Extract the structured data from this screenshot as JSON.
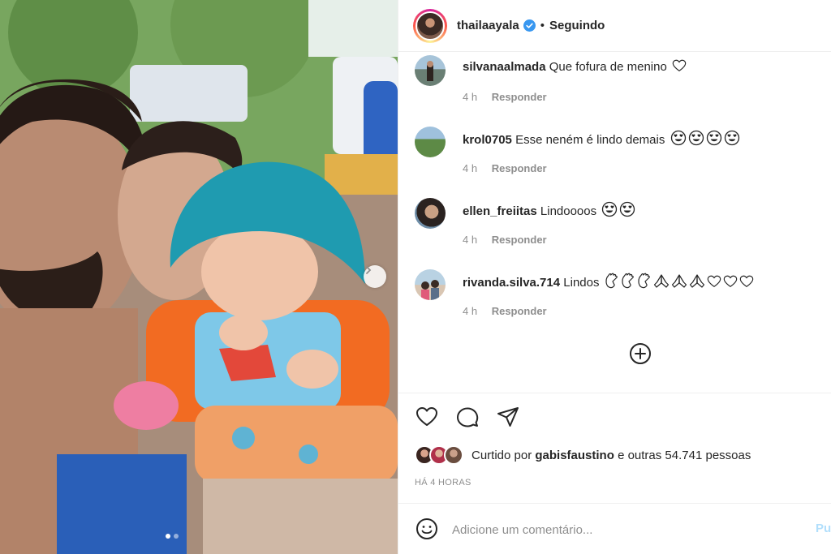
{
  "post": {
    "author": "thailaayala",
    "separator": "•",
    "follow_status": "Seguindo",
    "time_ago": "HÁ 4 HORAS"
  },
  "comments": [
    {
      "username": "silvanaalmada",
      "text": "Que fofura de menino",
      "emojis": [
        "white-heart"
      ],
      "time": "4 h",
      "reply_label": "Responder"
    },
    {
      "username": "krol0705",
      "text": "Esse neném é lindo demais",
      "emojis": [
        "heart-eyes",
        "heart-eyes",
        "heart-eyes",
        "heart-eyes"
      ],
      "time": "4 h",
      "reply_label": "Responder"
    },
    {
      "username": "ellen_freiitas",
      "text": "Lindoooos",
      "emojis": [
        "heart-eyes",
        "heart-eyes"
      ],
      "time": "4 h",
      "reply_label": "Responder"
    },
    {
      "username": "rivanda.silva.714",
      "text": "Lindos",
      "emojis": [
        "clapping-hands",
        "clapping-hands",
        "clapping-hands",
        "folded-hands",
        "folded-hands",
        "folded-hands",
        "white-heart",
        "white-heart",
        "white-heart"
      ],
      "time": "4 h",
      "reply_label": "Responder"
    }
  ],
  "likes": {
    "prefix": "Curtido por",
    "first_user": "gabisfaustino",
    "suffix": "e outras 54.741 pessoas"
  },
  "composer": {
    "placeholder": "Adicione um comentário...",
    "post_label": "Pu"
  },
  "icons": {
    "verified": "verified-badge-icon",
    "load_more": "plus-circle-icon",
    "like": "heart-icon",
    "comment": "comment-bubble-icon",
    "share": "paper-plane-icon",
    "emoji": "smiley-icon",
    "carousel_next": "chevron-right-icon"
  },
  "carousel": {
    "slide_count": 2,
    "active_index": 0
  },
  "colors": {
    "verified_blue": "#3897f0",
    "post_button_disabled": "#b2dffc",
    "meta_gray": "#8e8e8e"
  }
}
